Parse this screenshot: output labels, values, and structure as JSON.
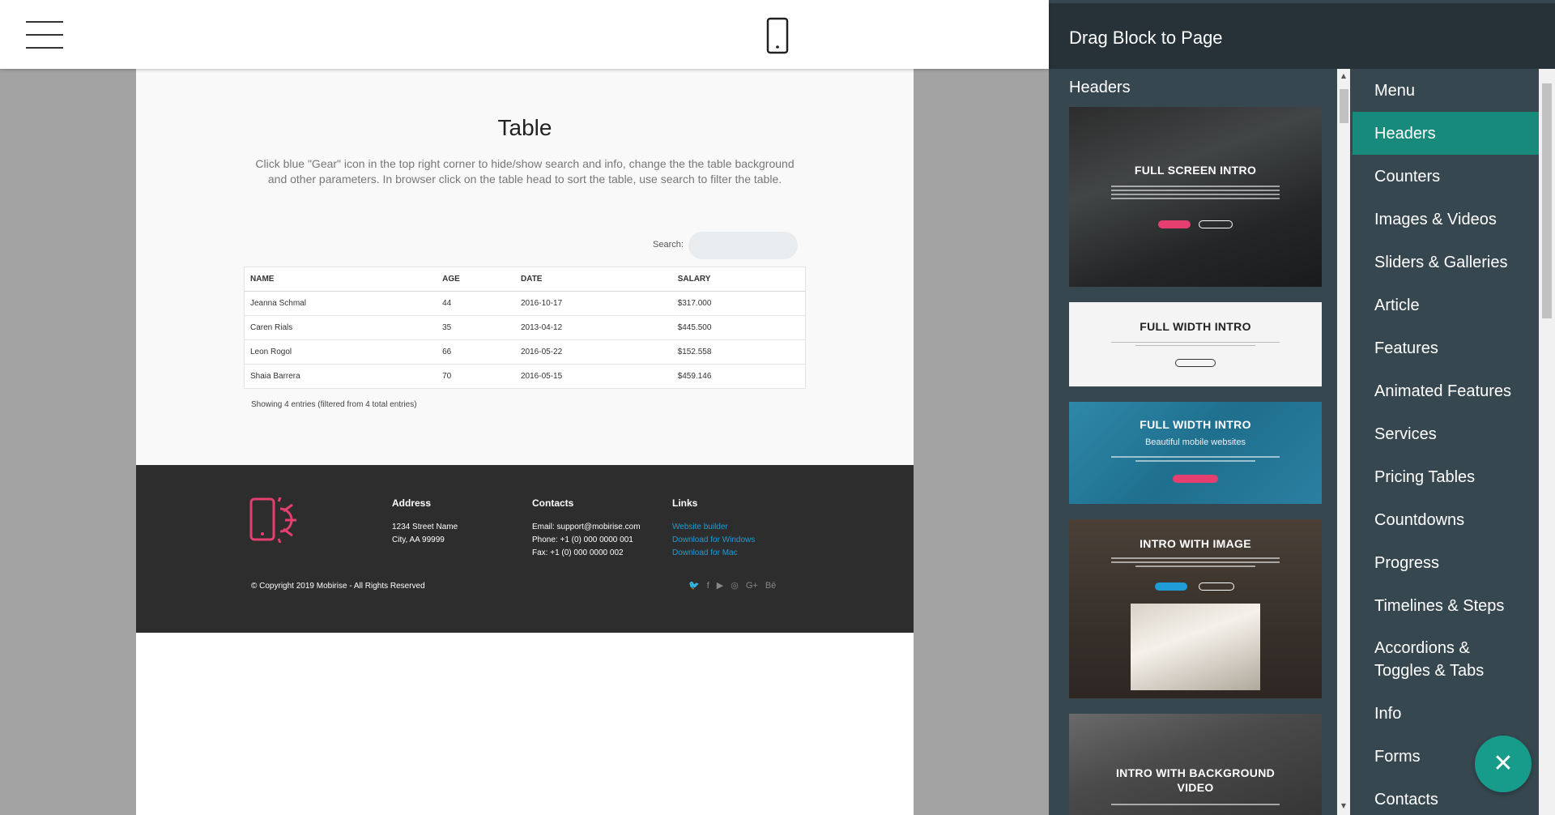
{
  "toolbar": {
    "menu_icon": "hamburger-icon",
    "preview_icon": "mobile-phone-icon"
  },
  "canvas": {
    "table_section": {
      "title": "Table",
      "description": "Click blue \"Gear\" icon in the top right corner to hide/show search and info, change the the table background and other parameters. In browser click on the table head to sort the table, use search to filter the table.",
      "search_label": "Search:",
      "search_value": "",
      "columns": [
        "NAME",
        "AGE",
        "DATE",
        "SALARY"
      ],
      "rows": [
        [
          "Jeanna Schmal",
          "44",
          "2016-10-17",
          "$317.000"
        ],
        [
          "Caren Rials",
          "35",
          "2013-04-12",
          "$445.500"
        ],
        [
          "Leon Rogol",
          "66",
          "2016-05-22",
          "$152.558"
        ],
        [
          "Shaia Barrera",
          "70",
          "2016-05-15",
          "$459.146"
        ]
      ],
      "info": "Showing 4 entries (filtered from 4 total entries)"
    },
    "footer": {
      "address_heading": "Address",
      "address_line1": "1234 Street Name",
      "address_line2": "City, AA 99999",
      "contacts_heading": "Contacts",
      "email": "Email: support@mobirise.com",
      "phone": "Phone: +1 (0) 000 0000 001",
      "fax": "Fax: +1 (0) 000 0000 002",
      "links_heading": "Links",
      "links": [
        "Website builder",
        "Download for Windows",
        "Download for Mac"
      ],
      "copyright": "© Copyright 2019 Mobirise - All Rights Reserved",
      "social_icons": [
        "twitter-icon",
        "facebook-icon",
        "youtube-icon",
        "instagram-icon",
        "google-plus-icon",
        "behance-icon"
      ],
      "social_glyphs": [
        "🐦",
        "f",
        "▶",
        "◎",
        "G+",
        "Bē"
      ],
      "accent_color": "#e43f6f",
      "link_color": "#1e9cd7"
    }
  },
  "panel": {
    "title": "Drag Block to Page",
    "section_heading": "Headers",
    "thumbnails": [
      {
        "title": "FULL SCREEN INTRO"
      },
      {
        "title": "FULL WIDTH INTRO"
      },
      {
        "title": "FULL WIDTH INTRO",
        "subtitle": "Beautiful mobile websites"
      },
      {
        "title": "INTRO WITH IMAGE"
      },
      {
        "title": "INTRO WITH BACKGROUND VIDEO"
      }
    ],
    "categories": [
      "Menu",
      "Headers",
      "Counters",
      "Images & Videos",
      "Sliders & Galleries",
      "Article",
      "Features",
      "Animated Features",
      "Services",
      "Pricing Tables",
      "Countdowns",
      "Progress",
      "Timelines & Steps",
      "Accordions & Toggles & Tabs",
      "Info",
      "Forms",
      "Contacts"
    ],
    "active_category": "Headers",
    "active_color": "#188a7c",
    "fab_icon": "close-icon"
  }
}
